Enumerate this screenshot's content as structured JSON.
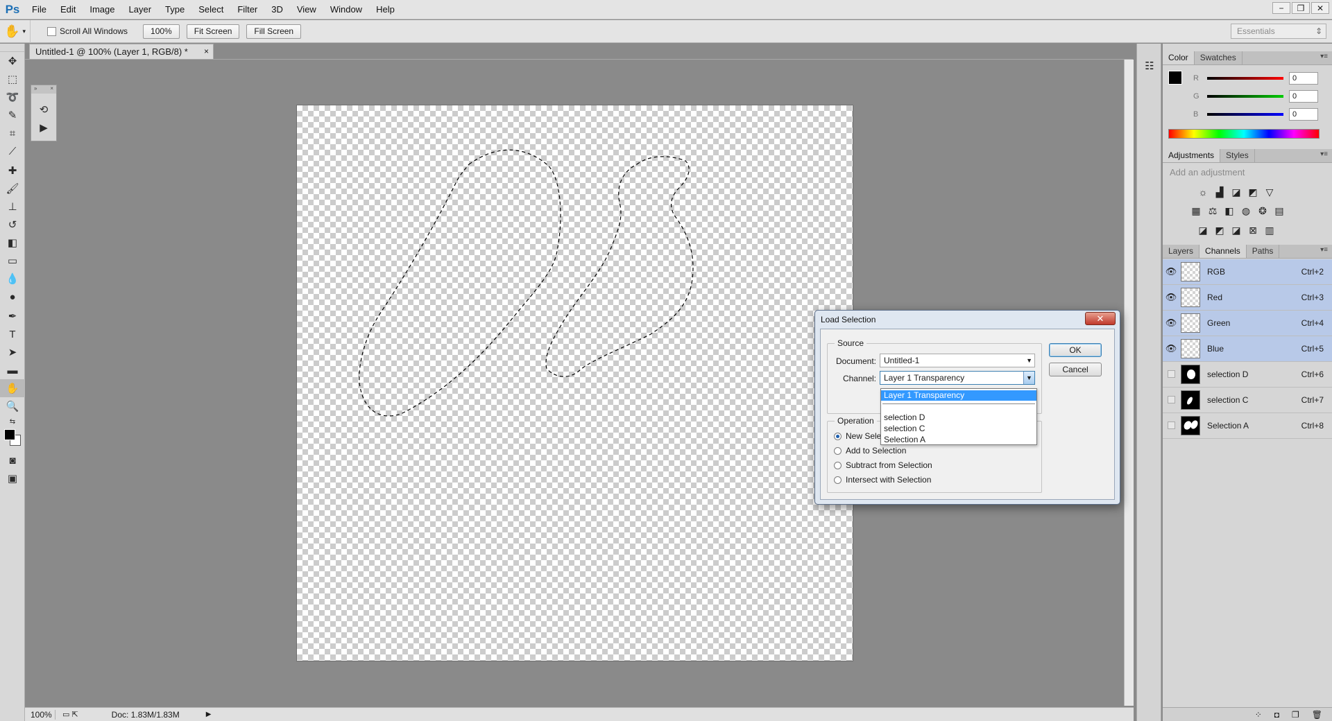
{
  "menubar": {
    "logo": "Ps",
    "items": [
      "File",
      "Edit",
      "Image",
      "Layer",
      "Type",
      "Select",
      "Filter",
      "3D",
      "View",
      "Window",
      "Help"
    ]
  },
  "window_controls": {
    "minimize": "−",
    "restore": "❐",
    "close": "✕"
  },
  "options_bar": {
    "scroll_all_windows": "Scroll All Windows",
    "zoom_100": "100%",
    "fit_screen": "Fit Screen",
    "fill_screen": "Fill Screen",
    "workspace": "Essentials"
  },
  "document": {
    "tab_title": "Untitled-1 @ 100% (Layer 1, RGB/8) *",
    "tab_close": "×"
  },
  "status": {
    "zoom": "100%",
    "doc": "Doc: 1.83M/1.83M"
  },
  "color_panel": {
    "tabs": [
      "Color",
      "Swatches"
    ],
    "r_label": "R",
    "g_label": "G",
    "b_label": "B",
    "r_value": "0",
    "g_value": "0",
    "b_value": "0"
  },
  "adjustments_panel": {
    "tabs": [
      "Adjustments",
      "Styles"
    ],
    "hint": "Add an adjustment"
  },
  "layers_panel": {
    "tabs": [
      "Layers",
      "Channels",
      "Paths"
    ],
    "channels": [
      {
        "name": "RGB",
        "shortcut": "Ctrl+2"
      },
      {
        "name": "Red",
        "shortcut": "Ctrl+3"
      },
      {
        "name": "Green",
        "shortcut": "Ctrl+4"
      },
      {
        "name": "Blue",
        "shortcut": "Ctrl+5"
      },
      {
        "name": "selection D",
        "shortcut": "Ctrl+6"
      },
      {
        "name": "selection C",
        "shortcut": "Ctrl+7"
      },
      {
        "name": "Selection A",
        "shortcut": "Ctrl+8"
      }
    ]
  },
  "dialog": {
    "title": "Load Selection",
    "close": "✕",
    "source_label": "Source",
    "document_label": "Document:",
    "document_value": "Untitled-1",
    "channel_label": "Channel:",
    "channel_value": "Layer 1 Transparency",
    "operation_label": "Operation",
    "operations": [
      "New Sele",
      "Add to Selection",
      "Subtract from Selection",
      "Intersect with Selection"
    ],
    "ok": "OK",
    "cancel": "Cancel",
    "dropdown_items": [
      "Layer 1 Transparency",
      "selection D",
      "selection C",
      "Selection A"
    ]
  },
  "colors": {
    "accent": "#3399ff",
    "selected_row": "#b8c9e8"
  }
}
